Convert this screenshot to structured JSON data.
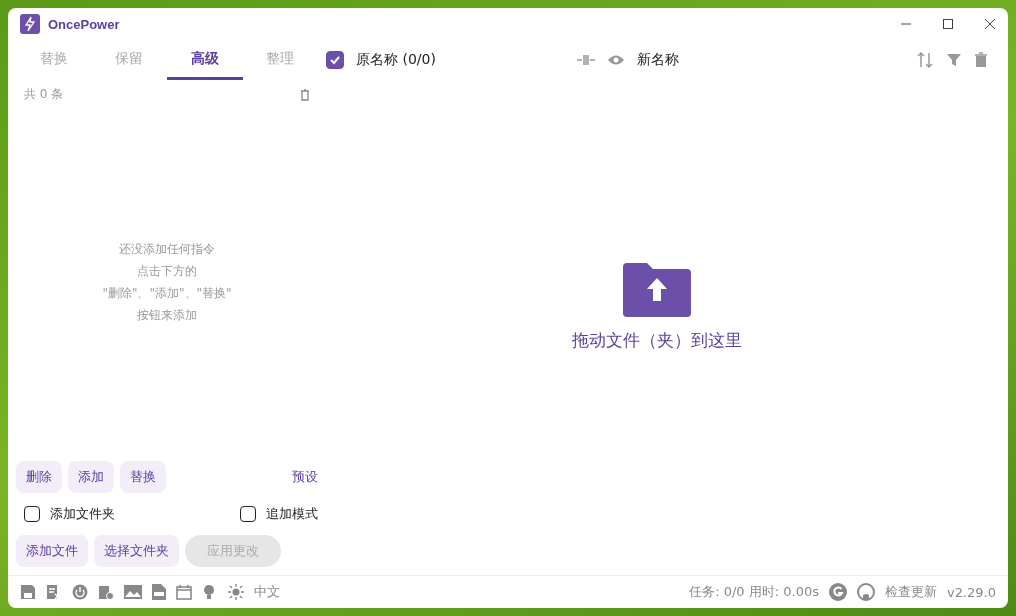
{
  "window": {
    "title": "OncePower"
  },
  "tabs": [
    {
      "label": "替换",
      "selected": false
    },
    {
      "label": "保留",
      "selected": false
    },
    {
      "label": "高级",
      "selected": true
    },
    {
      "label": "整理",
      "selected": false
    }
  ],
  "rule_list": {
    "count": "共 0 条",
    "empty_hint": [
      "还没添加任何指令",
      "点击下方的",
      "\"删除\"、\"添加\"、\"替换\"",
      "按钮来添加"
    ]
  },
  "rule_buttons": [
    "删除",
    "添加",
    "替换"
  ],
  "presets_link": "预设",
  "options": [
    {
      "label": "添加文件夹",
      "checked": false
    },
    {
      "label": "追加模式",
      "checked": false
    }
  ],
  "action_buttons": [
    {
      "label": "添加文件",
      "disabled": false
    },
    {
      "label": "选择文件夹",
      "disabled": false
    },
    {
      "label": "应用更改",
      "disabled": true
    }
  ],
  "file_header": {
    "original_name": {
      "label": "原名称 (0/0)",
      "checked": true
    },
    "new_name": "新名称"
  },
  "drop_zone": {
    "text": "拖动文件（夹）到这里"
  },
  "status_bar": {
    "language": "中文",
    "stats": "任务: 0/0 用时: 0.00s",
    "update_link": "检查更新",
    "version": "v2.29.0"
  }
}
